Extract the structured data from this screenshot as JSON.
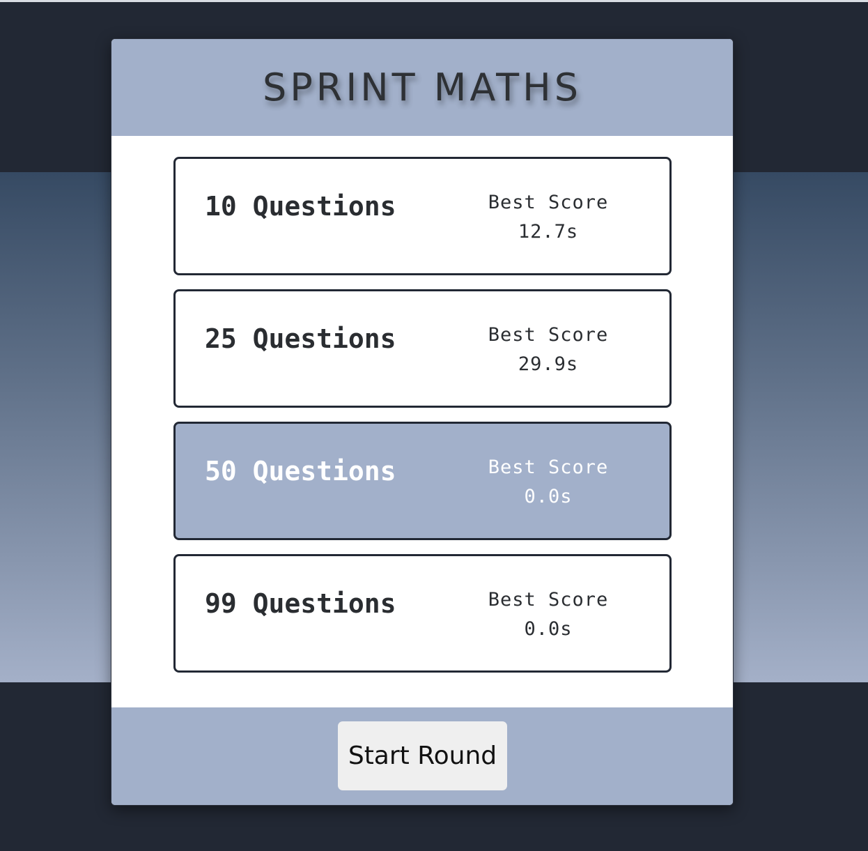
{
  "app": {
    "title": "SPRINT MATHS"
  },
  "options": [
    {
      "title": "10 Questions",
      "best_label": "Best Score",
      "best_value": "12.7s",
      "selected": false
    },
    {
      "title": "25 Questions",
      "best_label": "Best Score",
      "best_value": "29.9s",
      "selected": false
    },
    {
      "title": "50 Questions",
      "best_label": "Best Score",
      "best_value": "0.0s",
      "selected": true
    },
    {
      "title": "99 Questions",
      "best_label": "Best Score",
      "best_value": "0.0s",
      "selected": false
    }
  ],
  "footer": {
    "start_label": "Start Round"
  },
  "colors": {
    "background": "#222834",
    "accent": "#a2b0ca",
    "card": "#ffffff",
    "text": "#2a2d31"
  }
}
